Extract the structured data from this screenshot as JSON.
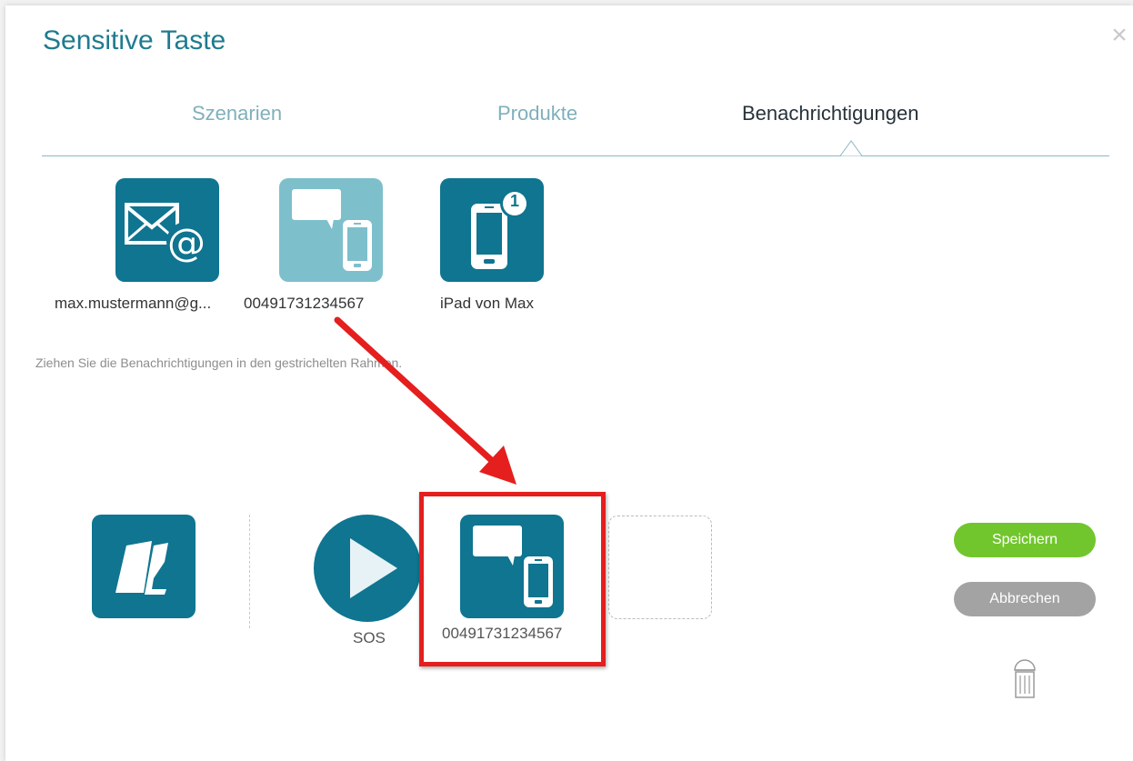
{
  "dialog": {
    "title": "Sensitive Taste",
    "close_glyph": "×"
  },
  "tabs": [
    {
      "label": "Szenarien",
      "active": false
    },
    {
      "label": "Produkte",
      "active": false
    },
    {
      "label": "Benachrichtigungen",
      "active": true
    }
  ],
  "available_notifications": [
    {
      "label": "max.mustermann@g...",
      "icon": "email-at-icon"
    },
    {
      "label": "00491731234567",
      "icon": "sms-phone-icon"
    },
    {
      "label": "iPad von Max",
      "icon": "push-device-icon",
      "badge": "1"
    }
  ],
  "hint": "Ziehen Sie die Benachrichtigungen in den gestrichelten Rahmen.",
  "scenario": {
    "trigger_icon": "sensitive-taste-icon",
    "action_label": "SOS",
    "assigned_label": "00491731234567"
  },
  "buttons": {
    "save": "Speichern",
    "cancel": "Abbrechen"
  },
  "colors": {
    "teal": "#0f7590",
    "teal_light": "#7ebfcc",
    "green": "#72c62d",
    "gray": "#a3a3a3",
    "highlight_red": "#e51e1e"
  }
}
